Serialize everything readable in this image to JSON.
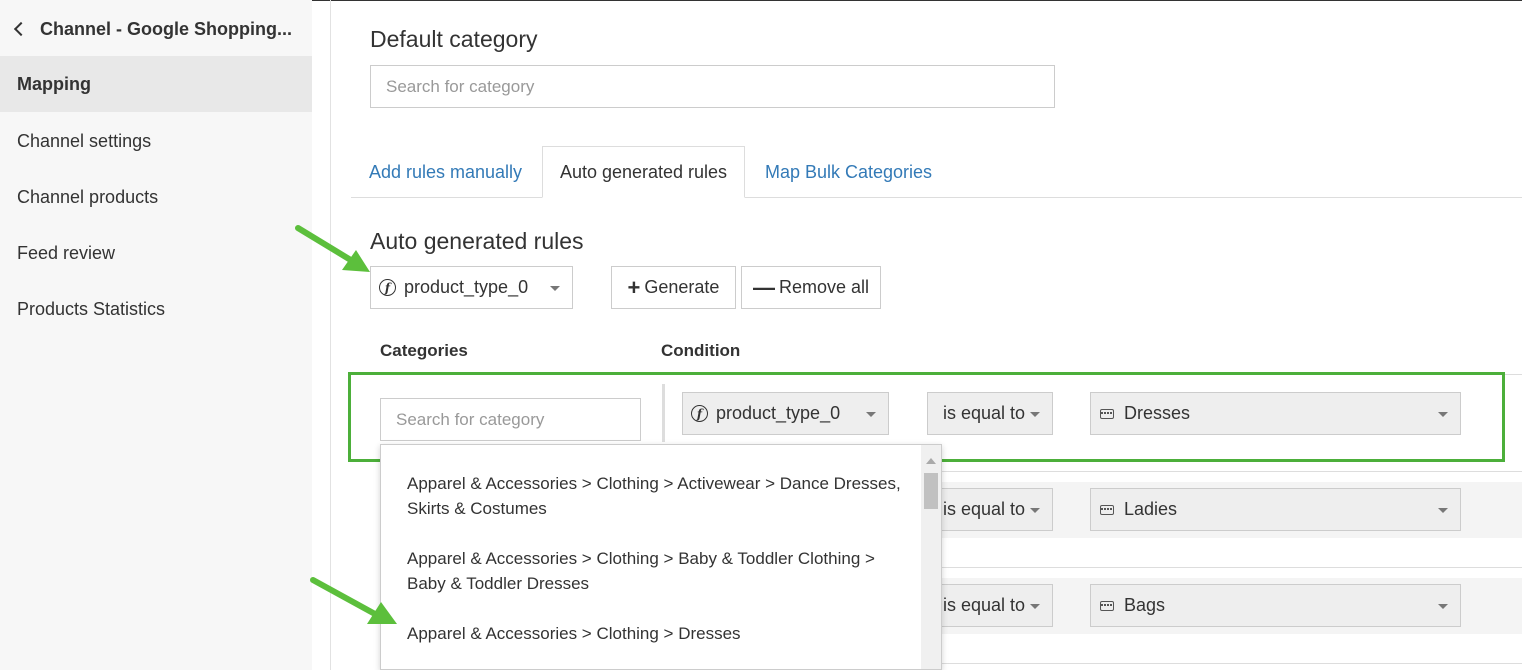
{
  "sidebar": {
    "back_label": "Channel - Google Shopping...",
    "items": [
      {
        "label": "Mapping",
        "active": true
      },
      {
        "label": "Channel settings"
      },
      {
        "label": "Channel products"
      },
      {
        "label": "Feed review"
      },
      {
        "label": "Products Statistics"
      }
    ]
  },
  "default_category": {
    "title": "Default category",
    "placeholder": "Search for category"
  },
  "tabs": [
    {
      "label": "Add rules manually"
    },
    {
      "label": "Auto generated rules",
      "active": true
    },
    {
      "label": "Map Bulk Categories"
    }
  ],
  "auto_rules": {
    "title": "Auto generated rules",
    "attribute_select": "product_type_0",
    "generate_label": "Generate",
    "remove_all_label": "Remove all"
  },
  "table": {
    "col_categories": "Categories",
    "col_condition": "Condition",
    "category_placeholder": "Search for category",
    "rows": [
      {
        "attribute": "product_type_0",
        "operator": "is equal to",
        "value": "Dresses"
      },
      {
        "operator": "is equal to",
        "value": "Ladies"
      },
      {
        "operator": "is equal to",
        "value": "Bags"
      }
    ]
  },
  "dropdown": {
    "options": [
      {
        "label": "Apparel & Accessories > Clothing > Activewear > Dance Dresses, Skirts & Costumes"
      },
      {
        "label": "Apparel & Accessories > Clothing > Baby & Toddler Clothing > Baby & Toddler Dresses"
      },
      {
        "label": "Apparel & Accessories > Clothing > Dresses"
      }
    ]
  },
  "colors": {
    "highlight": "#4caf3a",
    "link": "#337ab7",
    "arrow": "#5cbf3c"
  }
}
